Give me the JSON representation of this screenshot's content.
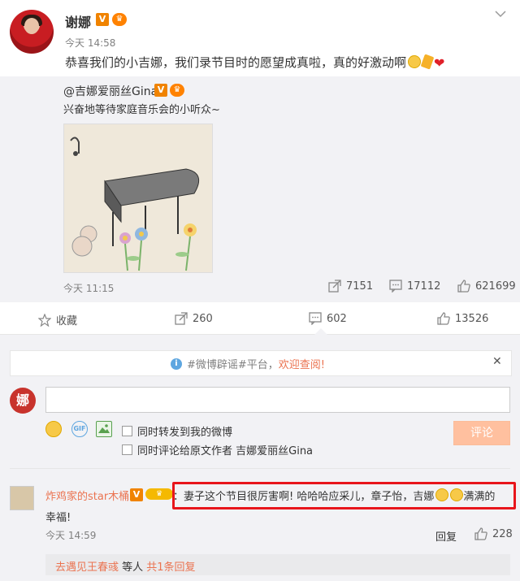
{
  "post": {
    "author": "谢娜",
    "time": "今天 14:58",
    "text": "恭喜我们的小吉娜，我们录节目时的愿望成真啦，真的好激动啊"
  },
  "repost": {
    "author": "@吉娜爱丽丝Gina",
    "text": "兴奋地等待家庭音乐会的小听众~",
    "time": "今天 11:15",
    "shares": "7151",
    "comments": "17112",
    "likes": "621699"
  },
  "actions": {
    "favorite": "收藏",
    "share": "260",
    "comment": "602",
    "like": "13526"
  },
  "notice": {
    "prefix": "#微博辟谣#平台，",
    "link": "欢迎查阅!"
  },
  "composer": {
    "input_value": "",
    "avatar_char": "娜",
    "option1": "同时转发到我的微博",
    "option2": "同时评论给原文作者 吉娜爱丽丝Gina",
    "submit": "评论"
  },
  "comment": {
    "author": "炸鸡家的star木桶",
    "text": "：妻子这个节目很厉害啊! 哈哈哈应采儿，章子怡，吉娜",
    "text_tail": "满满的",
    "text2": "幸福!",
    "time": "今天 14:59",
    "reply": "回复",
    "likes": "228",
    "sub_link": "去遇见王春彧",
    "sub_mid": " 等人 ",
    "sub_count": "共1条回复"
  },
  "badges": {
    "vip": "V",
    "crown": "♛"
  },
  "colors": {
    "accent": "#eb7350",
    "highlight": "#e8151b",
    "bg": "#f2f2f5"
  }
}
